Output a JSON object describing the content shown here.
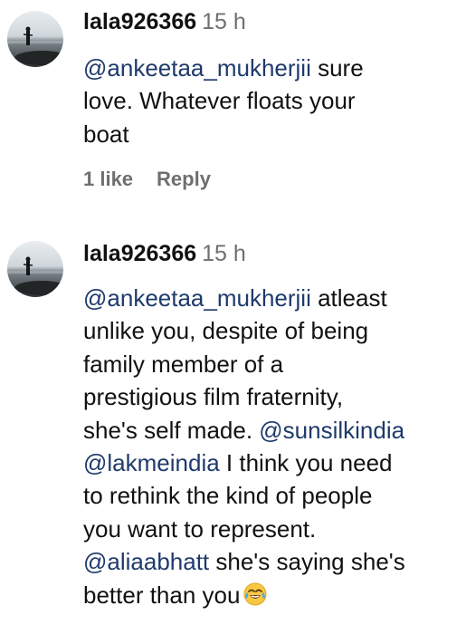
{
  "comments": [
    {
      "username": "lala926366",
      "time": "15 h",
      "lines": [
        [
          {
            "mention": "@ankeetaa_mukherjii"
          },
          {
            "text": " sure"
          }
        ],
        [
          {
            "text": "love. Whatever floats your"
          }
        ],
        [
          {
            "text": "boat"
          }
        ]
      ],
      "likes": "1 like",
      "reply": "Reply"
    },
    {
      "username": "lala926366",
      "time": "15 h",
      "lines": [
        [
          {
            "mention": "@ankeetaa_mukherjii"
          },
          {
            "text": " atleast"
          }
        ],
        [
          {
            "text": "unlike you, despite of being"
          }
        ],
        [
          {
            "text": "family member of a"
          }
        ],
        [
          {
            "text": "prestigious film fraternity,"
          }
        ],
        [
          {
            "text": "she's self made. "
          },
          {
            "mention": "@sunsilkindia"
          }
        ],
        [
          {
            "mention": "@lakmeindia"
          },
          {
            "text": " I think you need"
          }
        ],
        [
          {
            "text": "to rethink the kind of people"
          }
        ],
        [
          {
            "text": "you want to represent."
          }
        ],
        [
          {
            "mention": "@aliaabhatt"
          },
          {
            "text": " she's saying she's"
          }
        ],
        [
          {
            "text": "better than you"
          }
        ]
      ],
      "trailing_emoji": "face-with-tears-of-joy-icon"
    }
  ],
  "colors": {
    "text": "#111111",
    "muted": "#6f6f6f",
    "mention": "#1f3a6b"
  }
}
